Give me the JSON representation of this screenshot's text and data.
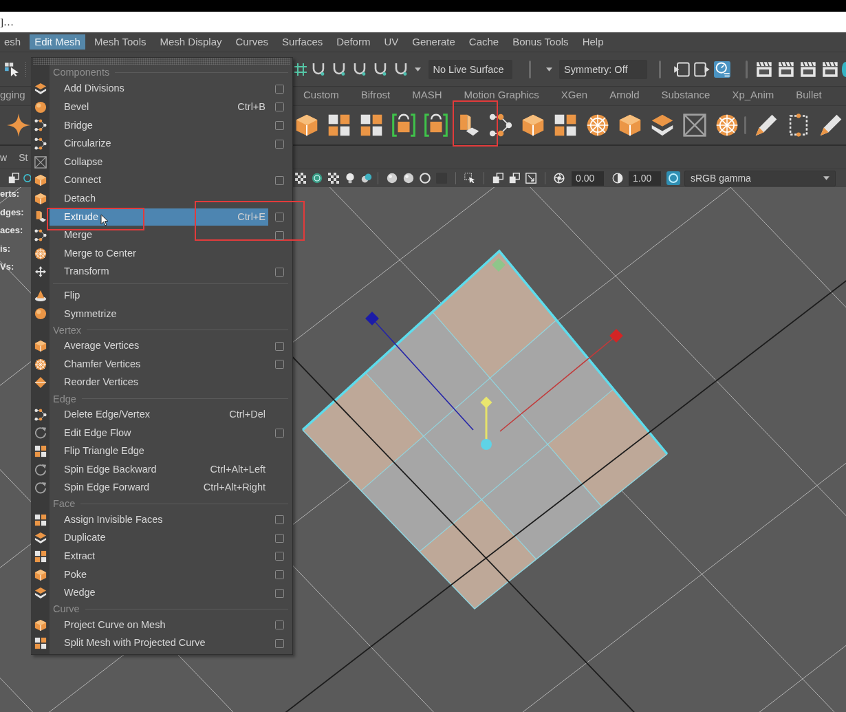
{
  "title_strip": {
    "text": "]…"
  },
  "menu_bar": [
    {
      "label": "esh",
      "selected": false
    },
    {
      "label": "Edit Mesh",
      "selected": true
    },
    {
      "label": "Mesh Tools",
      "selected": false
    },
    {
      "label": "Mesh Display",
      "selected": false
    },
    {
      "label": "Curves",
      "selected": false
    },
    {
      "label": "Surfaces",
      "selected": false
    },
    {
      "label": "Deform",
      "selected": false
    },
    {
      "label": "UV",
      "selected": false
    },
    {
      "label": "Generate",
      "selected": false
    },
    {
      "label": "Cache",
      "selected": false
    },
    {
      "label": "Bonus Tools",
      "selected": false
    },
    {
      "label": "Help",
      "selected": false
    }
  ],
  "status_line": {
    "live_surface": "No Live Surface",
    "symmetry": "Symmetry: Off",
    "toggles": [
      {
        "on": false
      },
      {
        "on": false
      },
      {
        "on": true
      }
    ]
  },
  "shelf": {
    "tabs": [
      {
        "label": "gging",
        "selected": false
      },
      {
        "label": "Custom",
        "selected": false
      },
      {
        "label": "Bifrost",
        "selected": false
      },
      {
        "label": "MASH",
        "selected": false
      },
      {
        "label": "Motion Graphics",
        "selected": false
      },
      {
        "label": "XGen",
        "selected": false
      },
      {
        "label": "Arnold",
        "selected": false
      },
      {
        "label": "Substance",
        "selected": false
      },
      {
        "label": "Xp_Anim",
        "selected": false
      },
      {
        "label": "Bullet",
        "selected": false
      }
    ],
    "marked": true
  },
  "panel_menu": [
    {
      "label": "w"
    },
    {
      "label": "St"
    }
  ],
  "viewport_toolbar": {
    "exposure": "0.00",
    "gamma": "1.00",
    "color_management": {
      "on": true
    },
    "color_space": "sRGB gamma"
  },
  "viewport": {
    "hud_labels": [
      "erts:",
      "dges:",
      "aces:",
      "is:",
      "Vs:"
    ],
    "mesh_faces": [
      {
        "selected": true
      },
      {
        "selected": false
      },
      {
        "selected": true
      },
      {
        "selected": false
      },
      {
        "selected": false
      },
      {
        "selected": false
      },
      {
        "selected": true
      },
      {
        "selected": false
      },
      {
        "selected": true
      }
    ]
  },
  "edit_mesh_menu": {
    "sections": [
      {
        "title": "Components",
        "items": [
          {
            "kind": "command",
            "label": "Add Divisions",
            "option_box": true,
            "selected": false,
            "marked": false
          },
          {
            "kind": "command",
            "label": "Bevel",
            "shortcut": "Ctrl+B",
            "option_box": true,
            "selected": false,
            "marked": false
          },
          {
            "kind": "command",
            "label": "Bridge",
            "option_box": true,
            "selected": false,
            "marked": false
          },
          {
            "kind": "command",
            "label": "Circularize",
            "option_box": true,
            "selected": false,
            "marked": false
          },
          {
            "kind": "command",
            "label": "Collapse",
            "option_box": false,
            "selected": false,
            "marked": false
          },
          {
            "kind": "command",
            "label": "Connect",
            "option_box": true,
            "selected": false,
            "marked": false
          },
          {
            "kind": "command",
            "label": "Detach",
            "option_box": false,
            "selected": false,
            "marked": false
          },
          {
            "kind": "command",
            "label": "Extrude",
            "shortcut": "Ctrl+E",
            "option_box": true,
            "selected": true,
            "marked": true
          },
          {
            "kind": "command",
            "label": "Merge",
            "option_box": true,
            "selected": false,
            "marked": false
          },
          {
            "kind": "command",
            "label": "Merge to Center",
            "option_box": false,
            "selected": false,
            "marked": false
          },
          {
            "kind": "command",
            "label": "Transform",
            "option_box": true,
            "selected": false,
            "marked": false
          },
          {
            "kind": "divider"
          },
          {
            "kind": "command",
            "label": "Flip",
            "option_box": false,
            "selected": false,
            "marked": false
          },
          {
            "kind": "command",
            "label": "Symmetrize",
            "option_box": false,
            "selected": false,
            "marked": false
          }
        ]
      },
      {
        "title": "Vertex",
        "items": [
          {
            "kind": "command",
            "label": "Average Vertices",
            "option_box": true,
            "selected": false,
            "marked": false
          },
          {
            "kind": "command",
            "label": "Chamfer Vertices",
            "option_box": true,
            "selected": false,
            "marked": false
          },
          {
            "kind": "command",
            "label": "Reorder Vertices",
            "option_box": false,
            "selected": false,
            "marked": false
          }
        ]
      },
      {
        "title": "Edge",
        "items": [
          {
            "kind": "command",
            "label": "Delete Edge/Vertex",
            "shortcut": "Ctrl+Del",
            "option_box": false,
            "selected": false,
            "marked": false
          },
          {
            "kind": "command",
            "label": "Edit Edge Flow",
            "option_box": true,
            "selected": false,
            "marked": false
          },
          {
            "kind": "command",
            "label": "Flip Triangle Edge",
            "option_box": false,
            "selected": false,
            "marked": false
          },
          {
            "kind": "command",
            "label": "Spin Edge Backward",
            "shortcut": "Ctrl+Alt+Left",
            "option_box": false,
            "selected": false,
            "marked": false
          },
          {
            "kind": "command",
            "label": "Spin Edge Forward",
            "shortcut": "Ctrl+Alt+Right",
            "option_box": false,
            "selected": false,
            "marked": false
          }
        ]
      },
      {
        "title": "Face",
        "items": [
          {
            "kind": "command",
            "label": "Assign Invisible Faces",
            "option_box": true,
            "selected": false,
            "marked": false
          },
          {
            "kind": "command",
            "label": "Duplicate",
            "option_box": true,
            "selected": false,
            "marked": false
          },
          {
            "kind": "command",
            "label": "Extract",
            "option_box": true,
            "selected": false,
            "marked": false
          },
          {
            "kind": "command",
            "label": "Poke",
            "option_box": true,
            "selected": false,
            "marked": false
          },
          {
            "kind": "command",
            "label": "Wedge",
            "option_box": true,
            "selected": false,
            "marked": false
          }
        ]
      },
      {
        "title": "Curve",
        "items": [
          {
            "kind": "command",
            "label": "Project Curve on Mesh",
            "option_box": true,
            "selected": false,
            "marked": false
          },
          {
            "kind": "command",
            "label": "Split Mesh with Projected Curve",
            "option_box": true,
            "selected": false,
            "marked": false
          }
        ]
      }
    ]
  }
}
